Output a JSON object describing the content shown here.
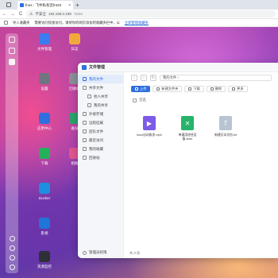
{
  "browser": {
    "tab_title": "fnos - 飞牛私有云fnOS",
    "tab_close": "×",
    "new_tab": "+",
    "nav": {
      "back": "←",
      "forward": "→",
      "reload": "C"
    },
    "url_warning": "不安全",
    "url_host": "192.168.0.199",
    "url_port": ":5666"
  },
  "bookmarks": {
    "import_label": "导入收藏夹",
    "hint_text": "需要访问快速访问，请将你的网页添加到收藏夹栏中，以",
    "link_text": "立即管理收藏夹"
  },
  "desktop": {
    "apps": [
      {
        "label": "文件管理",
        "icon": "folder-icon",
        "color": "#3b7cf0"
      },
      {
        "label": "日志",
        "icon": "log-icon",
        "color": "#f2a93b"
      },
      {
        "label": "设置",
        "icon": "gear-icon",
        "color": "#6f7680"
      },
      {
        "label": "回收站",
        "icon": "recycle-icon",
        "color": "#8a8f96"
      },
      {
        "label": "应用中心",
        "icon": "app-center-icon",
        "color": "#2f6fe0"
      },
      {
        "label": "备份",
        "icon": "backup-icon",
        "color": "#2ba36a"
      },
      {
        "label": "下载",
        "icon": "download-icon",
        "color": "#25b15b"
      },
      {
        "label": "相册",
        "icon": "photos-icon",
        "color": "#e0568f"
      },
      {
        "label": "Docker",
        "icon": "docker-icon",
        "color": "#1d8fe0"
      },
      {
        "label": "影视",
        "icon": "video-icon",
        "color": "#1f75d8"
      },
      {
        "label": "资源监控",
        "icon": "monitor-icon",
        "color": "#2f2f38"
      }
    ]
  },
  "file_manager": {
    "title": "文件管理",
    "nav_items": [
      {
        "label": "我的文件",
        "active": true,
        "sub": false
      },
      {
        "label": "共享文件",
        "active": false,
        "sub": false
      },
      {
        "label": "他人共享",
        "active": false,
        "sub": true
      },
      {
        "label": "我的共享",
        "active": false,
        "sub": true
      },
      {
        "label": "外接存储",
        "active": false,
        "sub": false
      },
      {
        "label": "远程挂载",
        "active": false,
        "sub": false
      },
      {
        "label": "团队文件",
        "active": false,
        "sub": false
      },
      {
        "label": "最近访问",
        "active": false,
        "sub": false
      },
      {
        "label": "我的收藏",
        "active": false,
        "sub": false
      },
      {
        "label": "回收站",
        "active": false,
        "sub": false
      }
    ],
    "footer_label": "管理员权限",
    "path": "我的文件 › ",
    "toolbar": {
      "upload": "上传",
      "new_folder": "新建文件夹",
      "download": "下载",
      "delete": "删除",
      "more": "更多"
    },
    "select_all": "全选",
    "files": [
      {
        "name": "linux自动收发.mp4",
        "icon": "video-file-icon",
        "color": "#7b5be8",
        "glyph": "▶"
      },
      {
        "name": "单通用途径设备.xlsm",
        "icon": "excel-file-icon",
        "color": "#26b36a",
        "glyph": "✕"
      },
      {
        "name": "新建文本文档.txt",
        "icon": "text-file-icon",
        "color": "#b9c4d2",
        "glyph": "T"
      }
    ],
    "status": "共 3 项"
  }
}
